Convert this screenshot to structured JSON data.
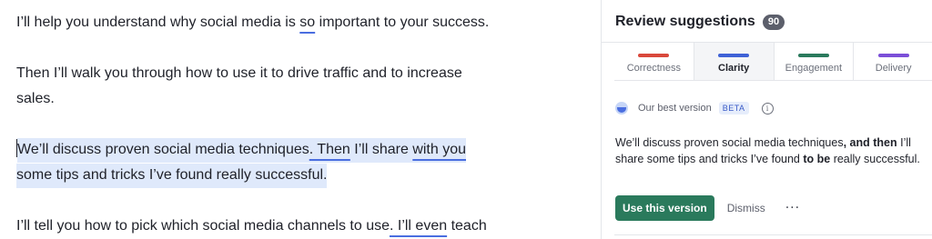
{
  "editor": {
    "p1": {
      "a": "I’ll help you understand why social media is ",
      "u": "so",
      "b": " important to your success."
    },
    "p2": {
      "line1": "Then I’ll walk you through how to use it to drive traffic and to increase",
      "line2": "sales."
    },
    "p3": {
      "a": "We’ll discuss proven social media techniques",
      "u1": ". Then",
      "b": " I’ll share ",
      "u2": "with you",
      "line2": "some tips and tricks I’ve found really successful."
    },
    "p4": {
      "a": "I’ll tell you how to pick which social media channels to use",
      "u": ". I’ll even",
      "b": " teach"
    }
  },
  "panel": {
    "title": "Review suggestions",
    "count": "90",
    "tabs": [
      {
        "label": "Correctness",
        "color": "#d9483b"
      },
      {
        "label": "Clarity",
        "color": "#3f62d6"
      },
      {
        "label": "Engagement",
        "color": "#2a7a5c"
      },
      {
        "label": "Delivery",
        "color": "#7b4fd8"
      }
    ],
    "active_tab": "Clarity",
    "card": {
      "best_label": "Our best version",
      "beta": "BETA",
      "info_icon": "ⓘ",
      "text": {
        "t1": "We’ll discuss proven social media techniques",
        "b1": ", and then",
        "t2": " I’ll share some tips and tricks I’ve found ",
        "b2": "to be",
        "t3": " really successful."
      },
      "primary_button": "Use this version",
      "dismiss_button": "Dismiss",
      "more_button": "···"
    }
  }
}
